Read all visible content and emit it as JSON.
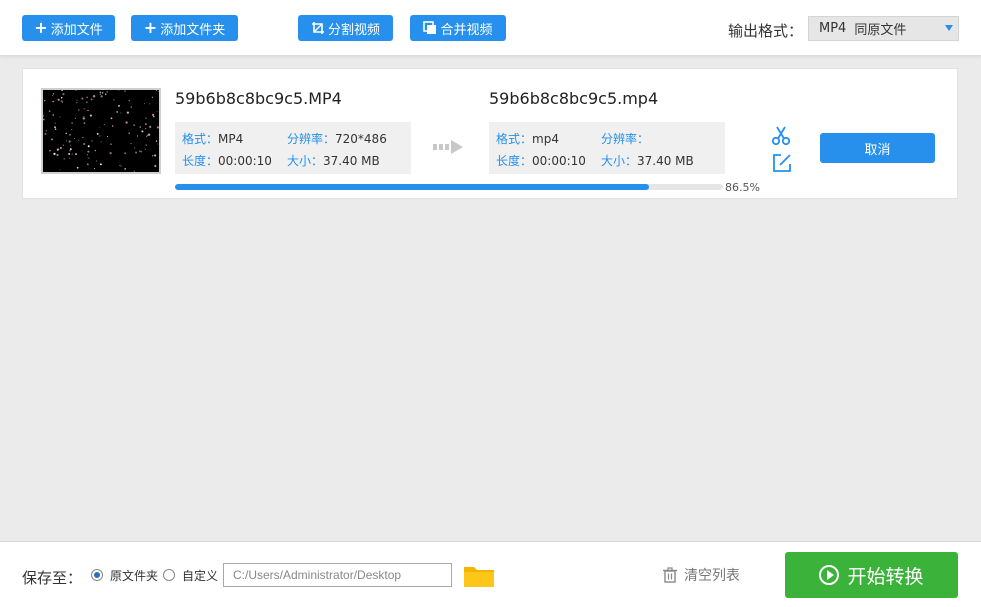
{
  "toolbar": {
    "add_file": "添加文件",
    "add_folder": "添加文件夹",
    "split_video": "分割视频",
    "merge_video": "合并视频",
    "output_format_label": "输出格式：",
    "output_format_value": "MP4",
    "output_format_option": "同原文件"
  },
  "task": {
    "source_name": "59b6b8c8bc9c5.MP4",
    "target_name": "59b6b8c8bc9c5.mp4",
    "source": {
      "format_key": "格式：",
      "format_val": "MP4",
      "res_key": "分辨率：",
      "res_val": "720*486",
      "duration_key": "长度：",
      "duration_val": "00:00:10",
      "size_key": "大小：",
      "size_val": "37.40 MB"
    },
    "target": {
      "format_key": "格式：",
      "format_val": "mp4",
      "res_key": "分辨率：",
      "res_val": "",
      "duration_key": "长度：",
      "duration_val": "00:00:10",
      "size_key": "大小：",
      "size_val": "37.40 MB"
    },
    "progress": 0.865,
    "progress_text": "86.5%",
    "cancel": "取消",
    "icons": {
      "cut": "scissors-icon",
      "edit": "edit-icon",
      "arrow": "convert-arrow-icon"
    }
  },
  "bottom": {
    "save_to": "保存至：",
    "option_original": "原文件夹",
    "option_custom": "自定义",
    "path_value": "C:/Users/Administrator/Desktop",
    "clear_list": "清空列表",
    "start": "开始转换"
  },
  "colors": {
    "accent": "#2690ec",
    "start": "#3bb33b",
    "background": "#ebebeb"
  }
}
